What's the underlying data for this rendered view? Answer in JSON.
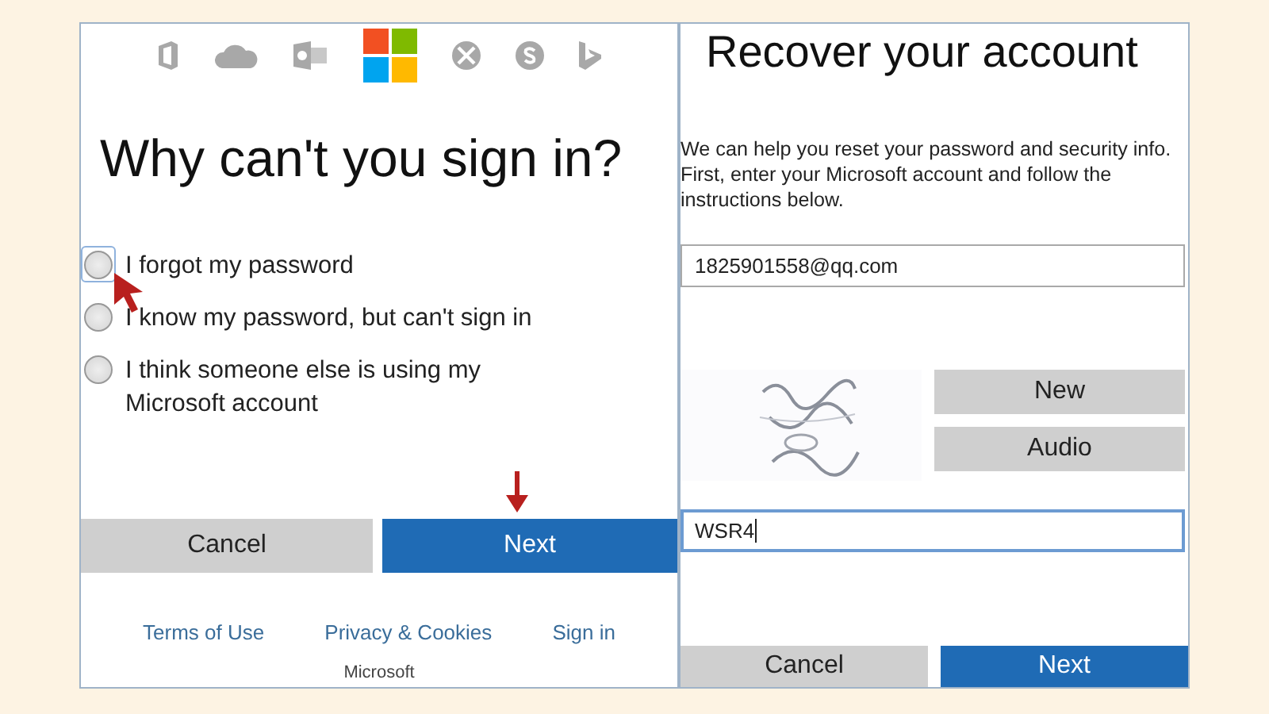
{
  "signin": {
    "heading": "Why can't you sign in?",
    "options": [
      {
        "label": "I forgot my password",
        "selected": false,
        "focused": true
      },
      {
        "label": "I know my password, but can't sign in",
        "selected": false,
        "focused": false
      },
      {
        "label": "I think someone else is using my Microsoft account",
        "selected": false,
        "focused": false
      }
    ],
    "buttons": [
      {
        "label": "Cancel",
        "kind": "secondary"
      },
      {
        "label": "Next",
        "kind": "primary"
      }
    ],
    "links": [
      "Terms of Use",
      "Privacy & Cookies",
      "Sign in"
    ],
    "footer": "Microsoft"
  },
  "recover": {
    "title": "Recover your account",
    "description": "We can help you reset your password and security info. First, enter your Microsoft account and follow the instructions below.",
    "account_field": {
      "value": "1825901558@qq.com",
      "focused": false
    },
    "captcha_buttons": [
      "New",
      "Audio"
    ],
    "code_field": {
      "value": "WSR4",
      "focused": true
    },
    "buttons": [
      {
        "label": "Cancel",
        "kind": "secondary"
      },
      {
        "label": "Next",
        "kind": "primary"
      }
    ]
  }
}
